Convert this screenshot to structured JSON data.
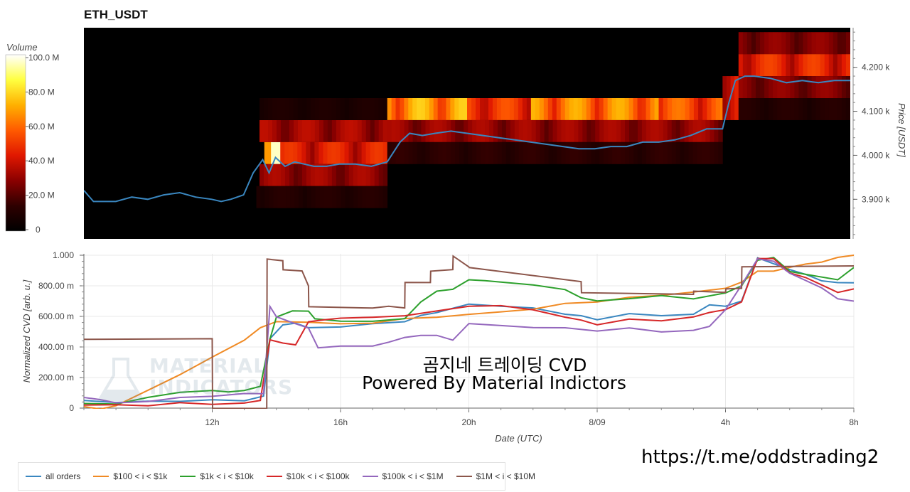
{
  "title": "ETH_USDT",
  "overlay": {
    "line1": "곰지네 트레이딩 CVD",
    "line2": "Powered By Material Indictors",
    "link": "https://t.me/oddstrading2"
  },
  "watermark": {
    "line1": "MATERIAL",
    "line2": "INDICATORS"
  },
  "chart_data": [
    {
      "type": "heatmap",
      "title": "ETH_USDT",
      "ylabel": "Price [USDT]",
      "ylim": [
        3810,
        4290
      ],
      "yticks": [
        {
          "value": 3900,
          "label": "3.900 k"
        },
        {
          "value": 4000,
          "label": "4.000 k"
        },
        {
          "value": 4100,
          "label": "4.100 k"
        },
        {
          "value": 4200,
          "label": "4.200 k"
        }
      ],
      "colorbar": {
        "title": "Volume",
        "min": 0,
        "max": 100,
        "ticks": [
          "0",
          "20.0 M",
          "40.0 M",
          "60.0 M",
          "80.0 M",
          "100.0 M"
        ],
        "colors": [
          "#000000",
          "#2e0000",
          "#8a0000",
          "#e01800",
          "#ff5a00",
          "#ffb000",
          "#ffff40",
          "#ffffff"
        ]
      },
      "x_range_hours": [
        0,
        24
      ],
      "volume_bands": [
        {
          "t0": 13.85,
          "t1": 14.0,
          "p0": 3980,
          "p1": 4030,
          "v": 100
        },
        {
          "t0": 14.0,
          "t1": 14.15,
          "p0": 3980,
          "p1": 4030,
          "v": 85
        },
        {
          "t0": 13.65,
          "t1": 13.85,
          "p0": 3980,
          "p1": 4030,
          "v": 55
        },
        {
          "t0": 13.5,
          "t1": 17.5,
          "p0": 4030,
          "p1": 4080,
          "v": 30
        },
        {
          "t0": 14.15,
          "t1": 17.5,
          "p0": 3980,
          "p1": 4030,
          "v": 40
        },
        {
          "t0": 13.5,
          "t1": 17.5,
          "p0": 3930,
          "p1": 3980,
          "v": 28
        },
        {
          "t0": 13.5,
          "t1": 17.5,
          "p0": 4080,
          "p1": 4130,
          "v": 8
        },
        {
          "t0": 13.4,
          "t1": 17.5,
          "p0": 3880,
          "p1": 3930,
          "v": 10
        },
        {
          "t0": 17.5,
          "t1": 20.0,
          "p0": 4080,
          "p1": 4130,
          "v": 62
        },
        {
          "t0": 20.0,
          "t1": 22.0,
          "p0": 4080,
          "p1": 4130,
          "v": 45
        },
        {
          "t0": 22.0,
          "t1": 26.0,
          "p0": 4080,
          "p1": 4130,
          "v": 58
        },
        {
          "t0": 17.5,
          "t1": 28.0,
          "p0": 4030,
          "p1": 4080,
          "v": 28
        },
        {
          "t0": 17.5,
          "t1": 28.0,
          "p0": 3980,
          "p1": 4030,
          "v": 12
        },
        {
          "t0": 26.0,
          "t1": 28.2,
          "p0": 4080,
          "p1": 4130,
          "v": 50
        },
        {
          "t0": 28.0,
          "t1": 28.5,
          "p0": 4080,
          "p1": 4180,
          "v": 40
        },
        {
          "t0": 28.5,
          "t1": 32.0,
          "p0": 4180,
          "p1": 4230,
          "v": 42
        },
        {
          "t0": 28.5,
          "t1": 32.0,
          "p0": 4230,
          "p1": 4280,
          "v": 25
        },
        {
          "t0": 28.5,
          "t1": 32.0,
          "p0": 4130,
          "p1": 4180,
          "v": 25
        },
        {
          "t0": 28.5,
          "t1": 32.0,
          "p0": 4080,
          "p1": 4130,
          "v": 10
        }
      ],
      "price_line": {
        "color": "#3a87c0",
        "t": [
          8.0,
          8.3,
          8.6,
          9.0,
          9.5,
          10.0,
          10.5,
          11.0,
          11.5,
          12.0,
          12.3,
          12.6,
          13.0,
          13.3,
          13.6,
          13.8,
          14.0,
          14.3,
          14.6,
          14.9,
          15.2,
          15.6,
          16.0,
          16.5,
          17.0,
          17.5,
          17.9,
          18.2,
          18.6,
          19.0,
          19.5,
          20.0,
          20.5,
          21.0,
          21.5,
          22.0,
          22.5,
          23.0,
          23.5,
          24.0,
          24.5,
          25.0,
          25.5,
          26.0,
          26.5,
          27.0,
          27.5,
          28.0,
          28.2,
          28.4,
          28.7,
          29.0,
          29.5,
          30.0,
          30.5,
          31.0,
          31.5,
          32.0
        ],
        "price": [
          3920,
          3895,
          3895,
          3895,
          3905,
          3900,
          3910,
          3915,
          3905,
          3900,
          3895,
          3900,
          3910,
          3960,
          3990,
          3960,
          3995,
          3975,
          3985,
          3980,
          3975,
          3975,
          3980,
          3980,
          3975,
          3985,
          4030,
          4050,
          4045,
          4050,
          4055,
          4050,
          4045,
          4040,
          4035,
          4030,
          4025,
          4020,
          4015,
          4015,
          4020,
          4020,
          4030,
          4030,
          4035,
          4045,
          4060,
          4060,
          4120,
          4170,
          4180,
          4180,
          4175,
          4165,
          4170,
          4165,
          4170,
          4170
        ]
      }
    },
    {
      "type": "line",
      "xlabel": "Date (UTC)",
      "ylabel": "Normalized CVD [arb. u.]",
      "ylim": [
        0,
        1
      ],
      "yticks": [
        "0",
        "200.00 m",
        "400.00 m",
        "600.00 m",
        "800.00 m",
        "1.000"
      ],
      "xticks": [
        {
          "hour": 12,
          "label": "12h"
        },
        {
          "hour": 16,
          "label": "16h"
        },
        {
          "hour": 20,
          "label": "20h"
        },
        {
          "hour": 24,
          "label": "8/09"
        },
        {
          "hour": 28,
          "label": "4h"
        },
        {
          "hour": 32,
          "label": "8h"
        }
      ],
      "x_range_hours": [
        8,
        32
      ],
      "series": [
        {
          "name": "all orders",
          "color": "#3a87c0",
          "t": [
            8.0,
            9.0,
            10.0,
            11.0,
            12.0,
            13.0,
            13.6,
            13.8,
            14.2,
            14.6,
            15.0,
            16.0,
            17.0,
            18.0,
            18.5,
            19.0,
            19.5,
            20.0,
            21.0,
            22.0,
            23.0,
            23.5,
            24.0,
            25.0,
            26.0,
            27.0,
            27.5,
            28.0,
            28.5,
            29.0,
            29.5,
            30.0,
            30.5,
            31.0,
            31.5,
            32.0
          ],
          "y": [
            0.05,
            0.04,
            0.04,
            0.05,
            0.05,
            0.05,
            0.08,
            0.45,
            0.55,
            0.55,
            0.53,
            0.53,
            0.55,
            0.57,
            0.6,
            0.63,
            0.65,
            0.68,
            0.67,
            0.65,
            0.62,
            0.6,
            0.58,
            0.62,
            0.6,
            0.62,
            0.67,
            0.67,
            0.7,
            0.98,
            0.95,
            0.9,
            0.88,
            0.83,
            0.82,
            0.82
          ]
        },
        {
          "name": "$100 < i < $1k",
          "color": "#f08a24",
          "t": [
            8.0,
            8.5,
            9.0,
            10.0,
            11.0,
            12.0,
            13.0,
            13.5,
            14.0,
            15.0,
            16.0,
            17.0,
            18.0,
            19.0,
            20.0,
            21.0,
            22.0,
            23.0,
            24.0,
            25.0,
            26.0,
            27.0,
            28.0,
            28.5,
            29.0,
            29.5,
            30.0,
            30.5,
            31.0,
            31.5,
            32.0
          ],
          "y": [
            0.01,
            0.0,
            0.01,
            0.12,
            0.22,
            0.33,
            0.45,
            0.52,
            0.57,
            0.56,
            0.55,
            0.56,
            0.58,
            0.6,
            0.61,
            0.63,
            0.65,
            0.68,
            0.7,
            0.72,
            0.74,
            0.76,
            0.78,
            0.83,
            0.89,
            0.9,
            0.92,
            0.94,
            0.96,
            0.98,
            1.0
          ]
        },
        {
          "name": "$1k < i < $10k",
          "color": "#2ca02c",
          "t": [
            8.0,
            9.0,
            10.0,
            11.0,
            12.0,
            12.5,
            13.0,
            13.5,
            13.8,
            14.0,
            14.5,
            15.0,
            15.2,
            16.0,
            17.0,
            18.0,
            18.5,
            19.0,
            19.5,
            20.0,
            20.5,
            21.0,
            22.0,
            23.0,
            23.5,
            24.0,
            25.0,
            26.0,
            27.0,
            28.0,
            28.5,
            29.0,
            29.5,
            30.0,
            30.5,
            31.0,
            31.5,
            32.0
          ],
          "y": [
            0.03,
            0.03,
            0.07,
            0.1,
            0.12,
            0.1,
            0.12,
            0.14,
            0.45,
            0.6,
            0.63,
            0.64,
            0.58,
            0.57,
            0.57,
            0.58,
            0.7,
            0.76,
            0.78,
            0.84,
            0.83,
            0.83,
            0.8,
            0.78,
            0.72,
            0.7,
            0.72,
            0.73,
            0.72,
            0.75,
            0.8,
            0.97,
            0.98,
            0.9,
            0.87,
            0.86,
            0.84,
            0.92
          ]
        },
        {
          "name": "$10k < i < $100k",
          "color": "#d62728",
          "t": [
            8.0,
            9.0,
            10.0,
            11.0,
            12.0,
            13.0,
            13.5,
            13.8,
            14.2,
            14.6,
            15.0,
            15.5,
            16.0,
            17.0,
            18.0,
            19.0,
            20.0,
            21.0,
            22.0,
            23.0,
            23.5,
            24.0,
            25.0,
            26.0,
            27.0,
            27.5,
            28.0,
            28.5,
            29.0,
            29.5,
            30.0,
            30.5,
            31.0,
            31.5,
            32.0
          ],
          "y": [
            0.02,
            0.02,
            0.02,
            0.03,
            0.03,
            0.03,
            0.05,
            0.45,
            0.42,
            0.42,
            0.56,
            0.58,
            0.59,
            0.59,
            0.61,
            0.63,
            0.67,
            0.67,
            0.64,
            0.6,
            0.57,
            0.55,
            0.58,
            0.57,
            0.6,
            0.62,
            0.65,
            0.69,
            0.98,
            0.98,
            0.88,
            0.86,
            0.8,
            0.76,
            0.78
          ]
        },
        {
          "name": "$100k < i < $1M",
          "color": "#9467bd",
          "t": [
            8.0,
            8.5,
            9.0,
            10.0,
            11.0,
            12.0,
            13.0,
            13.6,
            13.8,
            14.0,
            14.5,
            15.0,
            15.3,
            16.0,
            17.0,
            17.5,
            18.0,
            18.5,
            19.0,
            19.5,
            20.0,
            21.0,
            22.0,
            23.0,
            24.0,
            25.0,
            26.0,
            27.0,
            27.5,
            28.0,
            28.5,
            29.0,
            29.5,
            30.0,
            30.5,
            31.0,
            31.5,
            32.0
          ],
          "y": [
            0.07,
            0.05,
            0.04,
            0.04,
            0.07,
            0.08,
            0.09,
            0.1,
            0.66,
            0.6,
            0.56,
            0.52,
            0.4,
            0.4,
            0.41,
            0.43,
            0.46,
            0.48,
            0.47,
            0.45,
            0.55,
            0.54,
            0.53,
            0.52,
            0.51,
            0.52,
            0.5,
            0.51,
            0.53,
            0.65,
            0.8,
            0.98,
            0.96,
            0.88,
            0.84,
            0.78,
            0.72,
            0.7
          ]
        },
        {
          "name": "$1M < i < $10M",
          "color": "#8c564b",
          "t": [
            8.0,
            12.0,
            12.01,
            13.7,
            13.71,
            14.2,
            14.21,
            14.8,
            15.0,
            15.01,
            17.0,
            17.5,
            18.0,
            18.01,
            18.8,
            18.81,
            19.5,
            19.51,
            20.0,
            20.01,
            23.5,
            23.51,
            27.0,
            27.01,
            28.0,
            28.01,
            28.5,
            28.51,
            32.0
          ],
          "y": [
            0.45,
            0.45,
            0.0,
            0.0,
            0.97,
            0.97,
            0.9,
            0.9,
            0.8,
            0.66,
            0.66,
            0.66,
            0.66,
            0.82,
            0.82,
            0.9,
            0.9,
            1.0,
            0.92,
            0.92,
            0.83,
            0.75,
            0.75,
            0.76,
            0.76,
            0.78,
            0.78,
            0.93,
            0.93
          ]
        }
      ]
    }
  ]
}
